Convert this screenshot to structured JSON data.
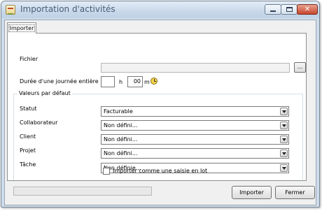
{
  "window": {
    "title": "Importation d'activités"
  },
  "tabs": [
    {
      "label": "Importer"
    }
  ],
  "form": {
    "fichier_label": "Fichier",
    "fichier_value": "",
    "browse_label": "...",
    "duree_label": "Durée d'une journée entière",
    "hours_value": "",
    "hours_unit": "h",
    "minutes_value": "00",
    "minutes_unit": "m"
  },
  "defaults_group": {
    "title": "Valeurs par défaut",
    "fields": [
      {
        "label": "Statut",
        "value": "Facturable"
      },
      {
        "label": "Collaborateur",
        "value": "Non défini..."
      },
      {
        "label": "Client",
        "value": "Non défini..."
      },
      {
        "label": "Projet",
        "value": "Non défini..."
      },
      {
        "label": "Tâche",
        "value": "Non définie..."
      }
    ]
  },
  "batch_checkbox": {
    "label": "Importer comme une saisie en lot",
    "checked": false
  },
  "buttons": {
    "import_label": "Importer",
    "close_label": "Fermer"
  },
  "icons": {
    "app": "app-import-icon",
    "clock": "clock-icon"
  }
}
